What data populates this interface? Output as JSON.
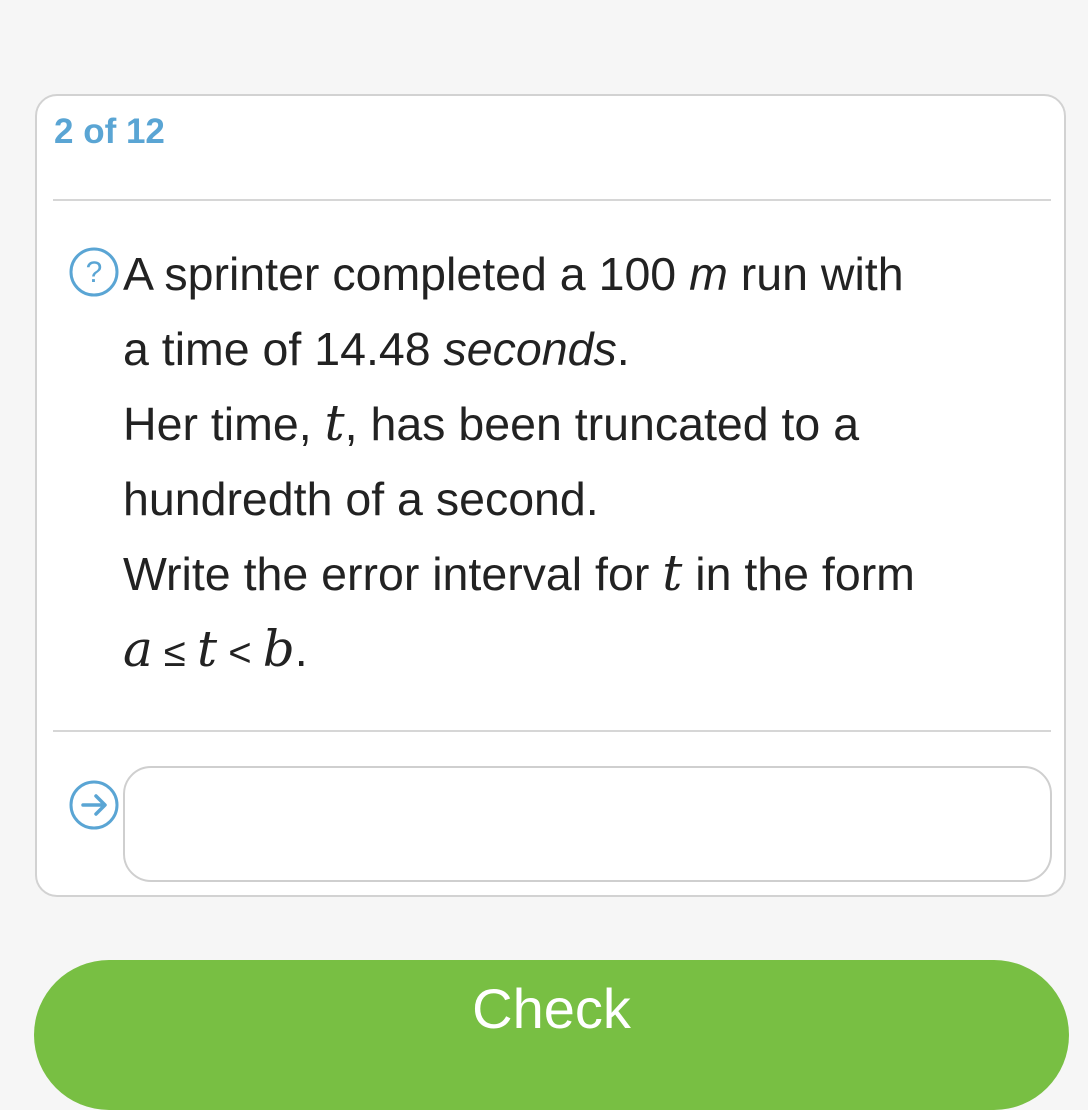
{
  "question": {
    "counter": "2 of 12",
    "lines": {
      "l1_pre": "A sprinter completed a 100 ",
      "l1_unit": "m",
      "l1_post": " run with",
      "l2_pre": "a time of 14.48 ",
      "l2_unit": "seconds",
      "l2_post": ".",
      "l3_pre": "Her time, ",
      "l3_var": "t",
      "l3_post": ", has been truncated to a",
      "l4": "hundredth of a second.",
      "l5_pre": "Write the error interval for ",
      "l5_var": "t",
      "l5_post": " in the form",
      "l6_a": "a",
      "l6_le": " ≤ ",
      "l6_t": "t",
      "l6_lt": " < ",
      "l6_b": "b",
      "l6_end": "."
    }
  },
  "answer": {
    "value": "",
    "placeholder": ""
  },
  "check_label": "Check",
  "icons": {
    "help": "question-circle-icon",
    "submit": "arrow-right-circle-icon"
  },
  "colors": {
    "accent_blue": "#5aa5d4",
    "check_green": "#78bf43",
    "text": "#222222",
    "border": "#d2d2d2"
  }
}
